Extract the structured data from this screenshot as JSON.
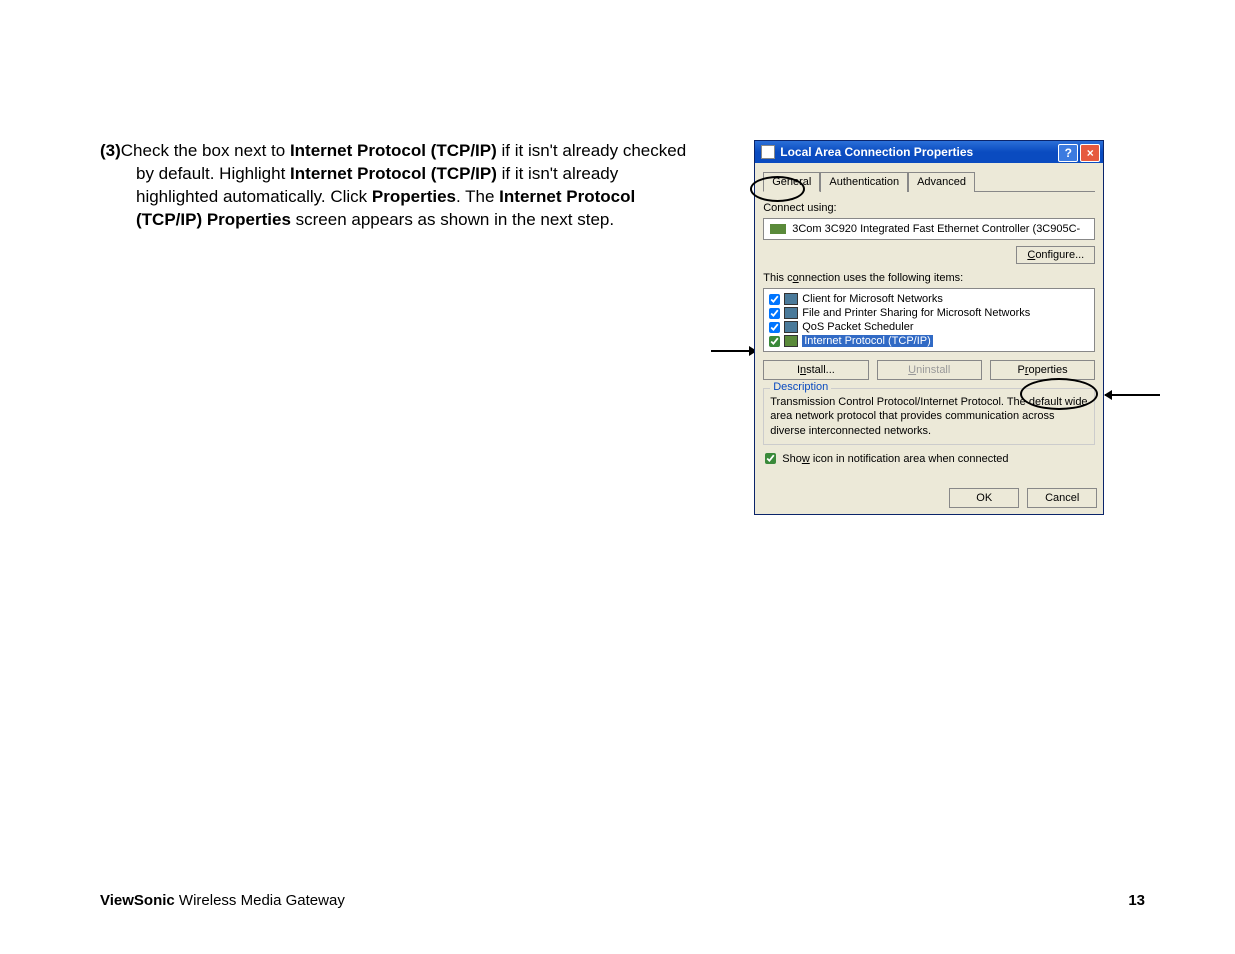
{
  "step": {
    "num": "(3)",
    "t1": "Check the box next to ",
    "b1": "Internet Protocol (TCP/IP)",
    "t2": " if it isn't already checked by default. Highlight ",
    "b2": "Internet Protocol (TCP/IP)",
    "t3": " if it isn't already highlighted automatically. Click ",
    "b3": "Properties",
    "t4": ". The ",
    "b4": "Internet Protocol (TCP/IP) Properties",
    "t5": " screen appears as shown in the next step."
  },
  "dialog": {
    "title": "Local Area Connection Properties",
    "help": "?",
    "close": "×",
    "tabs": [
      "General",
      "Authentication",
      "Advanced"
    ],
    "connect_label": "Connect using:",
    "device": "3Com 3C920 Integrated Fast Ethernet Controller (3C905C-",
    "configure_btn": "Configure...",
    "uses_label": "This connection uses the following items:",
    "items": [
      "Client for Microsoft Networks",
      "File and Printer Sharing for Microsoft Networks",
      "QoS Packet Scheduler",
      "Internet Protocol (TCP/IP)"
    ],
    "install_btn": "Install...",
    "uninstall_btn": "Uninstall",
    "properties_btn": "Properties",
    "desc_label": "Description",
    "desc_text": "Transmission Control Protocol/Internet Protocol. The default wide area network protocol that provides communication across diverse interconnected networks.",
    "show_icon": "Show icon in notification area when connected",
    "ok_btn": "OK",
    "cancel_btn": "Cancel"
  },
  "footer": {
    "brand": "ViewSonic",
    "product": " Wireless Media Gateway",
    "page": "13"
  }
}
